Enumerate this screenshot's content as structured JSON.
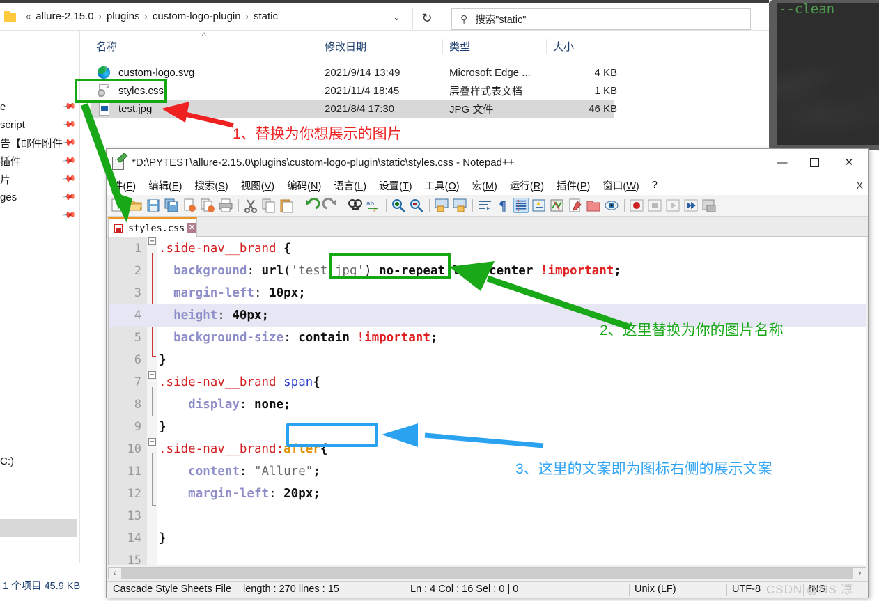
{
  "terminal": {
    "text": "--clean"
  },
  "explorer": {
    "breadcrumb": {
      "chevron_prefix": "«",
      "items": [
        "allure-2.15.0",
        "plugins",
        "custom-logo-plugin",
        "static"
      ],
      "separator": "›",
      "dropdown_icon": "chevron-down",
      "refresh_icon": "↻"
    },
    "search": {
      "placeholder": "搜索\"static\"",
      "icon": "search-icon"
    },
    "columns": {
      "name": "名称",
      "date": "修改日期",
      "type": "类型",
      "size": "大小",
      "sort_indicator": "^"
    },
    "files": [
      {
        "name": "custom-logo.svg",
        "date": "2021/9/14 13:49",
        "type": "Microsoft Edge ...",
        "size": "4 KB",
        "icon": "edge-icon",
        "selected": false
      },
      {
        "name": "styles.css",
        "date": "2021/11/4 18:45",
        "type": "层叠样式表文档",
        "size": "1 KB",
        "icon": "css-file-icon",
        "selected": false
      },
      {
        "name": "test.jpg",
        "date": "2021/8/4 17:30",
        "type": "JPG 文件",
        "size": "46 KB",
        "icon": "jpg-file-icon",
        "selected": true
      }
    ],
    "sidebar_items": [
      "e",
      "script",
      "告【邮件附件",
      "插件",
      "片",
      "ges",
      "",
      "",
      "C:)"
    ],
    "statusbar": "1 个项目  45.9 KB"
  },
  "notepad": {
    "title": "*D:\\PYTEST\\allure-2.15.0\\plugins\\custom-logo-plugin\\static\\styles.css - Notepad++",
    "window_buttons": {
      "minimize": "—",
      "maximize": "❐",
      "close": "✕"
    },
    "menu": [
      {
        "label": "件(",
        "key": "F",
        "tail": ")"
      },
      {
        "label": "编辑(",
        "key": "E",
        "tail": ")"
      },
      {
        "label": "搜索(",
        "key": "S",
        "tail": ")"
      },
      {
        "label": "视图(",
        "key": "V",
        "tail": ")"
      },
      {
        "label": "编码(",
        "key": "N",
        "tail": ")"
      },
      {
        "label": "语言(",
        "key": "L",
        "tail": ")"
      },
      {
        "label": "设置(",
        "key": "T",
        "tail": ")"
      },
      {
        "label": "工具(",
        "key": "O",
        "tail": ")"
      },
      {
        "label": "宏(",
        "key": "M",
        "tail": ")"
      },
      {
        "label": "运行(",
        "key": "R",
        "tail": ")"
      },
      {
        "label": "插件(",
        "key": "P",
        "tail": ")"
      },
      {
        "label": "窗口(",
        "key": "W",
        "tail": ")"
      },
      {
        "label": "?",
        "key": "",
        "tail": ""
      }
    ],
    "menu_close": "X",
    "tab": {
      "label": "styles.css",
      "close": "✕",
      "modified": true
    },
    "code_lines": [
      {
        "n": "1",
        "segments": [
          {
            "t": "sel",
            "v": ".side-nav__brand"
          },
          {
            "t": "op",
            "v": " "
          },
          {
            "t": "brace",
            "v": "{"
          }
        ]
      },
      {
        "n": "2",
        "segments": [
          {
            "t": "op",
            "v": "  "
          },
          {
            "t": "prop",
            "v": "background"
          },
          {
            "t": "op",
            "v": ": "
          },
          {
            "t": "val",
            "v": "url"
          },
          {
            "t": "op",
            "v": "("
          },
          {
            "t": "str",
            "v": "'test.jpg'"
          },
          {
            "t": "op",
            "v": ") "
          },
          {
            "t": "val",
            "v": "no-repeat left center "
          },
          {
            "t": "imp",
            "v": "!important"
          },
          {
            "t": "val",
            "v": ";"
          }
        ]
      },
      {
        "n": "3",
        "segments": [
          {
            "t": "op",
            "v": "  "
          },
          {
            "t": "prop",
            "v": "margin-left"
          },
          {
            "t": "op",
            "v": ": "
          },
          {
            "t": "val",
            "v": "10px;"
          }
        ]
      },
      {
        "n": "4",
        "segments": [
          {
            "t": "op",
            "v": "  "
          },
          {
            "t": "prop",
            "v": "height"
          },
          {
            "t": "op",
            "v": ": "
          },
          {
            "t": "val",
            "v": "40px;"
          }
        ],
        "highlight": true
      },
      {
        "n": "5",
        "segments": [
          {
            "t": "op",
            "v": "  "
          },
          {
            "t": "prop",
            "v": "background-size"
          },
          {
            "t": "op",
            "v": ": "
          },
          {
            "t": "val",
            "v": "contain "
          },
          {
            "t": "imp",
            "v": "!important"
          },
          {
            "t": "val",
            "v": ";"
          }
        ]
      },
      {
        "n": "6",
        "segments": [
          {
            "t": "brace",
            "v": "}"
          }
        ]
      },
      {
        "n": "7",
        "segments": [
          {
            "t": "sel",
            "v": ".side-nav__brand "
          },
          {
            "t": "tag",
            "v": "span"
          },
          {
            "t": "brace",
            "v": "{"
          }
        ]
      },
      {
        "n": "8",
        "segments": [
          {
            "t": "op",
            "v": "    "
          },
          {
            "t": "prop",
            "v": "display"
          },
          {
            "t": "op",
            "v": ": "
          },
          {
            "t": "val",
            "v": "none;"
          }
        ]
      },
      {
        "n": "9",
        "segments": [
          {
            "t": "brace",
            "v": "}"
          }
        ]
      },
      {
        "n": "10",
        "segments": [
          {
            "t": "sel",
            "v": ".side-nav__brand:"
          },
          {
            "t": "pseudo",
            "v": "after"
          },
          {
            "t": "brace",
            "v": "{"
          }
        ]
      },
      {
        "n": "11",
        "segments": [
          {
            "t": "op",
            "v": "    "
          },
          {
            "t": "prop",
            "v": "content"
          },
          {
            "t": "op",
            "v": ": "
          },
          {
            "t": "str",
            "v": "\"Allure\""
          },
          {
            "t": "val",
            "v": ";"
          }
        ]
      },
      {
        "n": "12",
        "segments": [
          {
            "t": "op",
            "v": "    "
          },
          {
            "t": "prop",
            "v": "margin-left"
          },
          {
            "t": "op",
            "v": ": "
          },
          {
            "t": "val",
            "v": "20px;"
          }
        ]
      },
      {
        "n": "13",
        "segments": []
      },
      {
        "n": "14",
        "segments": [
          {
            "t": "brace",
            "v": "}"
          }
        ]
      },
      {
        "n": "15",
        "segments": []
      }
    ],
    "statusbar": {
      "language": "Cascade Style Sheets File",
      "length_lines": "length : 270    lines : 15",
      "position": "Ln : 4    Col : 16    Sel : 0 | 0",
      "eol": "Unix (LF)",
      "encoding": "UTF-8",
      "insert_mode": "INS"
    },
    "scroll_left_arrow": "‹",
    "scroll_right_arrow": "›"
  },
  "annotations": [
    {
      "id": "note-1",
      "text": "1、替换为你想展示的图片",
      "color": "#ef2020"
    },
    {
      "id": "note-2",
      "text": "2、这里替换为你的图片名称",
      "color": "#18a818"
    },
    {
      "id": "note-3",
      "text": "3、这里的文案即为图标右侧的展示文案",
      "color": "#32a5f5"
    }
  ],
  "watermark": "CSDN @NS 凉"
}
